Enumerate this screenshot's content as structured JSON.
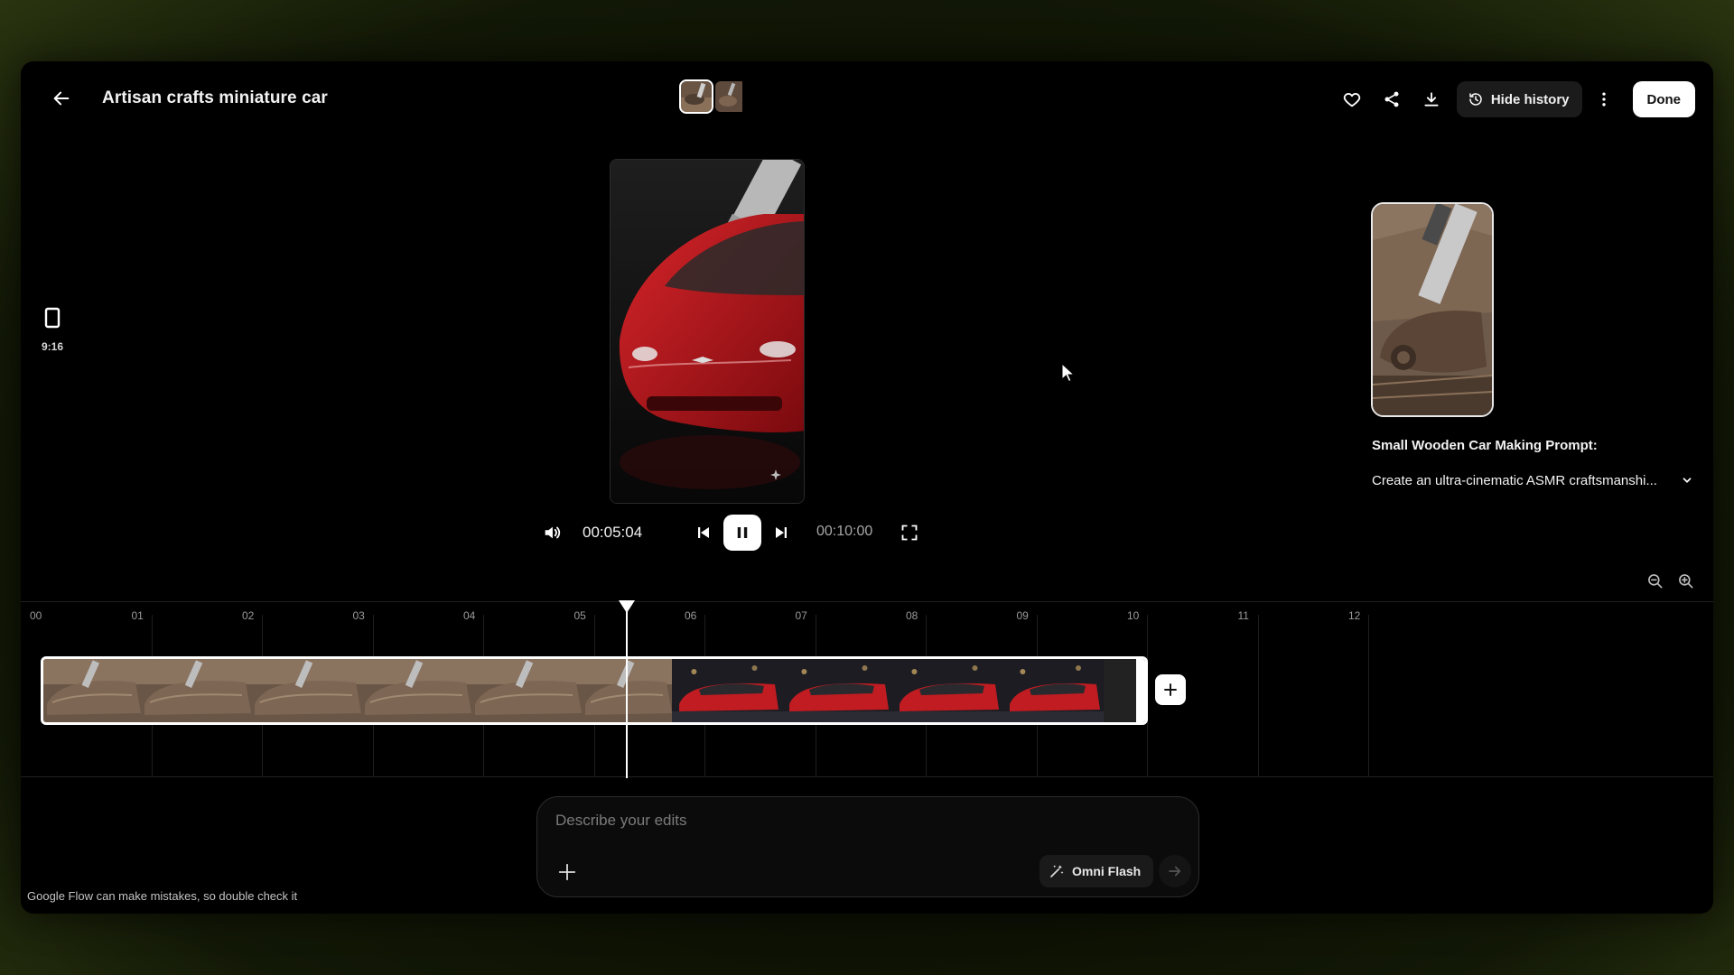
{
  "header": {
    "title": "Artisan crafts miniature car",
    "hide_history_label": "Hide history",
    "done_label": "Done"
  },
  "aspect": {
    "label": "9:16"
  },
  "player": {
    "current_time": "00:05:04",
    "total_time": "00:10:00"
  },
  "panel": {
    "prompt_title": "Small Wooden Car Making Prompt:",
    "prompt_text": "Create an ultra-cinematic ASMR craftsmanshi..."
  },
  "timeline": {
    "ticks": [
      "00",
      "01",
      "02",
      "03",
      "04",
      "05",
      "06",
      "07",
      "08",
      "09",
      "10",
      "11",
      "12"
    ],
    "playhead_seconds": 5.3
  },
  "editor": {
    "placeholder": "Describe your edits",
    "model_label": "Omni Flash"
  },
  "footer": {
    "disclaimer": "Google Flow can make mistakes, so double check it"
  },
  "colors": {
    "background": "#000000",
    "accent": "#ffffff",
    "car_red": "#b5141a",
    "wood": "#6b5747"
  }
}
